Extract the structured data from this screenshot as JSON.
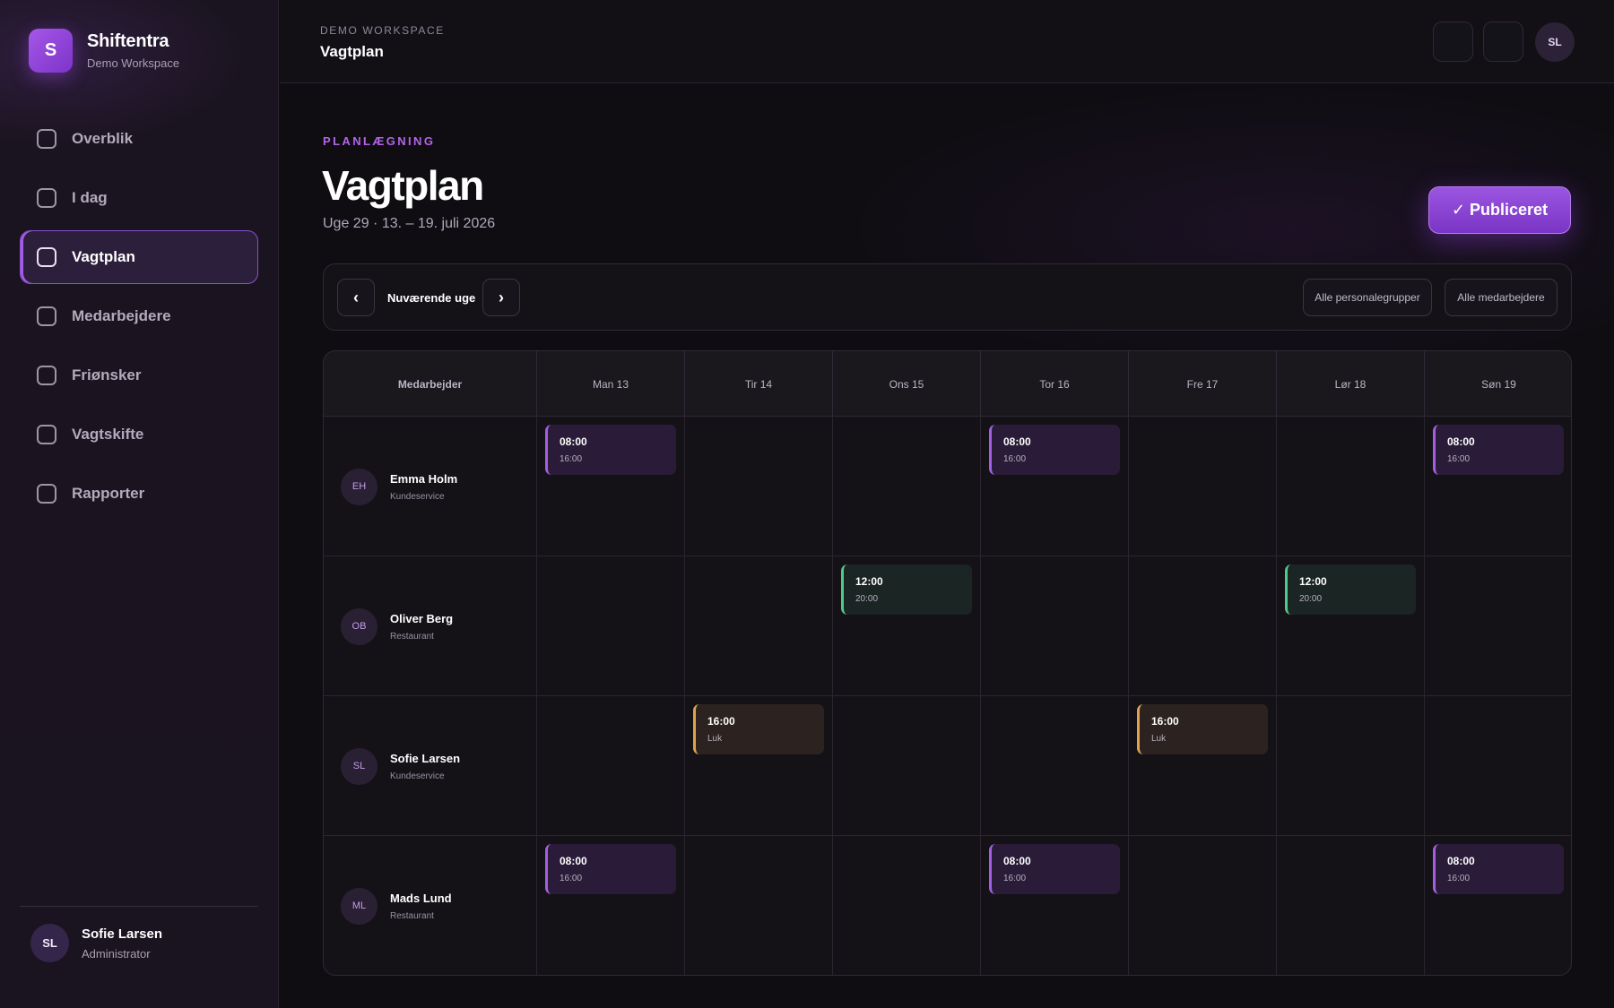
{
  "brand": {
    "logo_letter": "S",
    "name": "Shiftentra",
    "workspace": "Demo Workspace"
  },
  "nav": {
    "items": [
      {
        "label": "Overblik"
      },
      {
        "label": "I dag"
      },
      {
        "label": "Vagtplan",
        "active": true
      },
      {
        "label": "Medarbejdere"
      },
      {
        "label": "Friønsker"
      },
      {
        "label": "Vagtskifte"
      },
      {
        "label": "Rapporter"
      }
    ]
  },
  "user": {
    "initials": "SL",
    "name": "Sofie Larsen",
    "role": "Administrator"
  },
  "topbar": {
    "kicker": "DEMO WORKSPACE",
    "title": "Vagtplan",
    "avatar_initials": "SL"
  },
  "page": {
    "kicker": "PLANLÆGNING",
    "title": "Vagtplan",
    "subtitle": "Uge 29 · 13. – 19. juli 2026",
    "publish_label": "✓ Publiceret"
  },
  "toolbar": {
    "prev_label": "‹",
    "next_label": "›",
    "week_label": "Nuværende uge",
    "filter_groups": "Alle personalegrupper",
    "filter_employees": "Alle medarbejdere"
  },
  "schedule": {
    "employee_header": "Medarbejder",
    "days": [
      "Man 13",
      "Tir 14",
      "Ons 15",
      "Tor 16",
      "Fre 17",
      "Lør 18",
      "Søn 19"
    ],
    "employees": [
      {
        "initials": "EH",
        "name": "Emma Holm",
        "department": "Kundeservice",
        "shifts": [
          {
            "day": 0,
            "start": "08:00",
            "end": "16:00",
            "color": "purple"
          },
          {
            "day": 3,
            "start": "08:00",
            "end": "16:00",
            "color": "purple"
          },
          {
            "day": 6,
            "start": "08:00",
            "end": "16:00",
            "color": "purple"
          }
        ]
      },
      {
        "initials": "OB",
        "name": "Oliver Berg",
        "department": "Restaurant",
        "shifts": [
          {
            "day": 2,
            "start": "12:00",
            "end": "20:00",
            "color": "green"
          },
          {
            "day": 5,
            "start": "12:00",
            "end": "20:00",
            "color": "green"
          }
        ]
      },
      {
        "initials": "SL",
        "name": "Sofie Larsen",
        "department": "Kundeservice",
        "shifts": [
          {
            "day": 1,
            "start": "16:00",
            "end": "Luk",
            "color": "orange"
          },
          {
            "day": 4,
            "start": "16:00",
            "end": "Luk",
            "color": "orange"
          }
        ]
      },
      {
        "initials": "ML",
        "name": "Mads Lund",
        "department": "Restaurant",
        "shifts": [
          {
            "day": 0,
            "start": "08:00",
            "end": "16:00",
            "color": "purple"
          },
          {
            "day": 3,
            "start": "08:00",
            "end": "16:00",
            "color": "purple"
          },
          {
            "day": 6,
            "start": "08:00",
            "end": "16:00",
            "color": "purple"
          }
        ]
      }
    ]
  },
  "colors": {
    "accent": "#a45ee3",
    "green": "#4fc98a",
    "orange": "#e0a24a",
    "background": "#0f0d12"
  }
}
